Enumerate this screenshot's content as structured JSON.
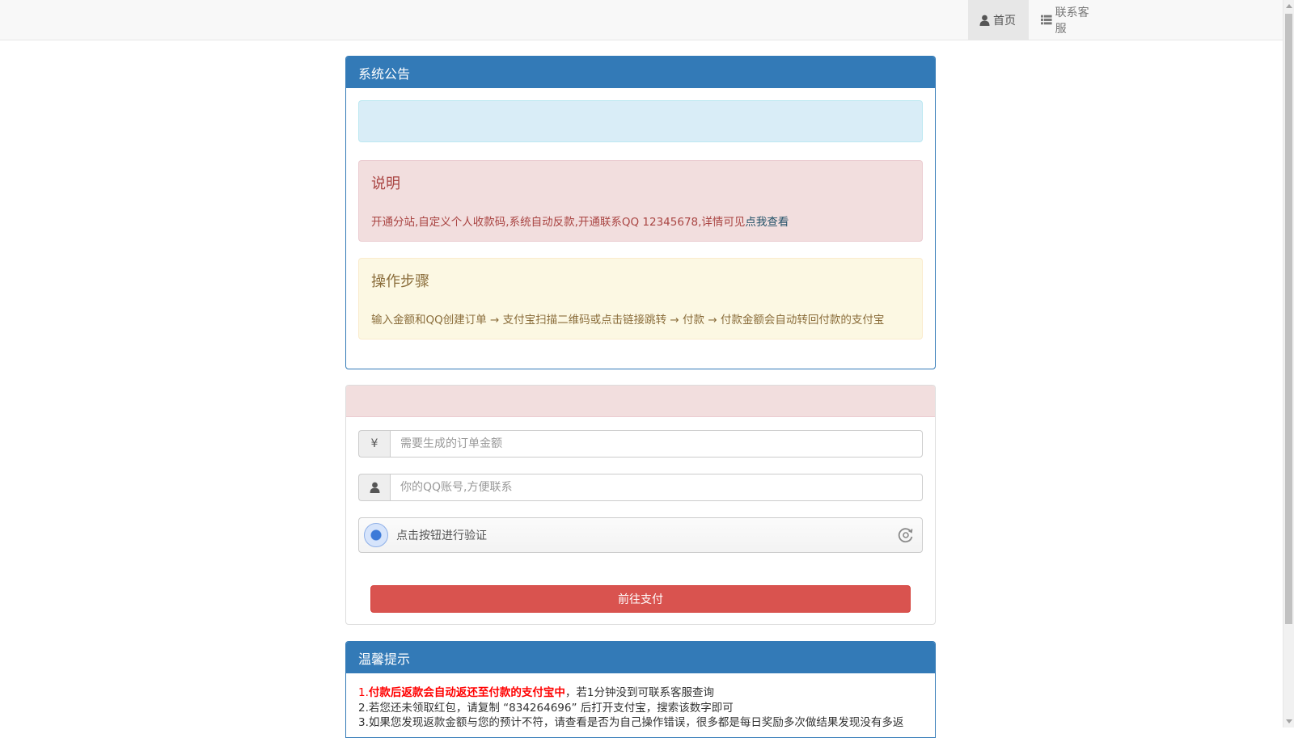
{
  "navbar": {
    "items": [
      {
        "label": "首页",
        "icon": "user-icon",
        "active": true
      },
      {
        "label": "联系客服",
        "icon": "list-icon",
        "active": false
      }
    ]
  },
  "notice_panel": {
    "title": "系统公告",
    "info_alert_text": "",
    "danger_alert": {
      "heading": "说明",
      "text": "开通分站,自定义个人收款码,系统自动反款,开通联系QQ 12345678,详情可见",
      "link_text": "点我查看"
    },
    "warning_alert": {
      "heading": "操作步骤",
      "text": "输入金额和QQ创建订单 → 支付宝扫描二维码或点击链接跳转 → 付款 → 付款金额会自动转回付款的支付宝"
    }
  },
  "order_panel": {
    "title": "",
    "amount": {
      "icon": "yen-icon",
      "addon_text": "¥",
      "placeholder": "需要生成的订单金额",
      "value": ""
    },
    "qq": {
      "icon": "user-icon",
      "placeholder": "你的QQ账号,方便联系",
      "value": ""
    },
    "captcha": {
      "label": "点击按钮进行验证",
      "icon": "refresh-icon"
    },
    "submit_label": "前往支付",
    "colors": {
      "submit": "#d9534f"
    }
  },
  "tips_panel": {
    "title": "温馨提示",
    "line1_prefix": "1.",
    "line1_bold": "付款后返款会自动返还至付款的支付宝中",
    "line1_rest": "，若1分钟没到可联系客服查询",
    "line2": "2.若您还未领取红包，请复制 “834264696” 后打开支付宝，搜索该数字即可",
    "line3": "3.如果您发现返款金额与您的预计不符，请查看是否为自己操作错误，很多都是每日奖励多次做结果发现没有多返"
  },
  "colors": {
    "primary": "#337ab7",
    "navbar_bg": "#f8f8f8"
  }
}
